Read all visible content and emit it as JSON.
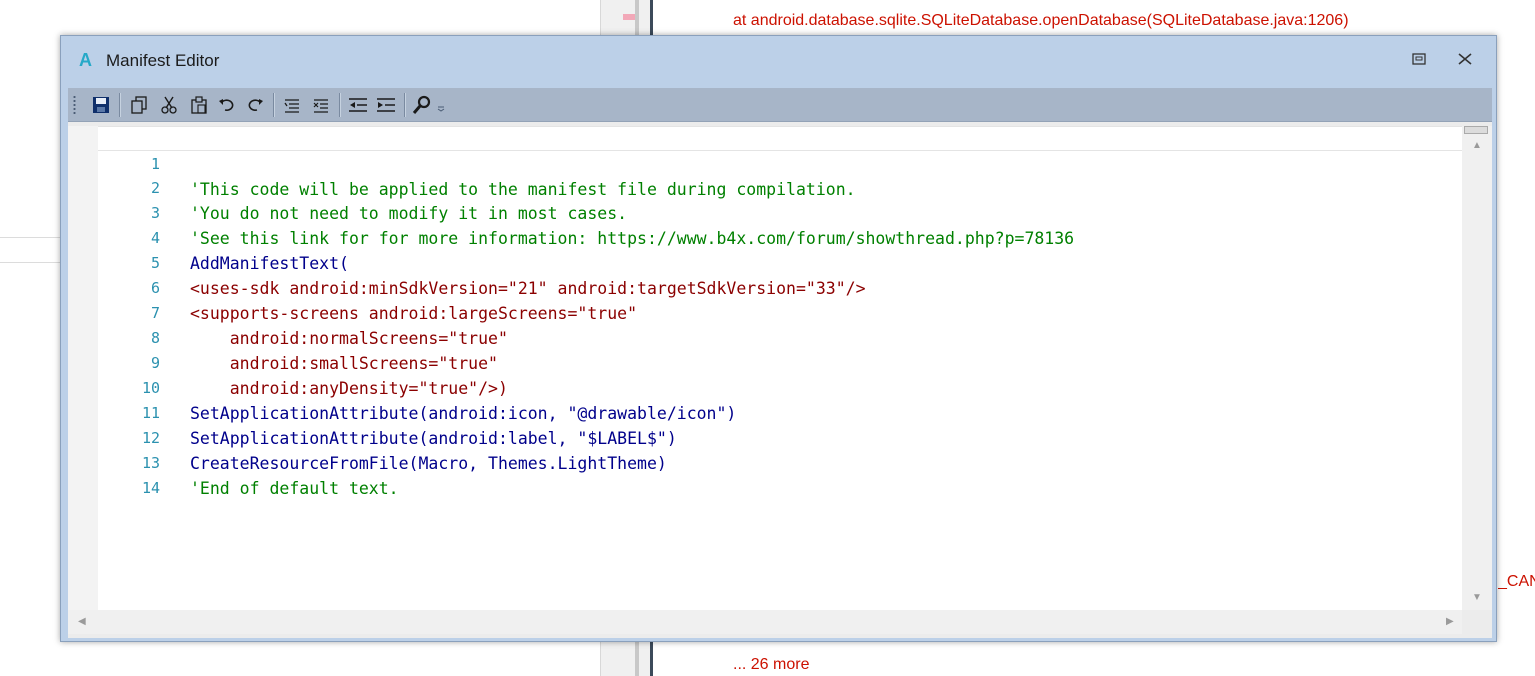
{
  "background": {
    "log_lines": [
      "at android.database.sqlite.SQLiteDatabase.openDatabase(SQLiteDatabase.java:1206)",
      "... 26 more"
    ],
    "partial_right_text": "_CAN"
  },
  "window": {
    "title": "Manifest Editor",
    "logo_letter": "A"
  },
  "toolbar": {
    "buttons": [
      "save-icon",
      "copy-icon",
      "cut-icon",
      "paste-icon",
      "undo-icon",
      "redo-icon",
      "comment-icon",
      "uncomment-icon",
      "outdent-icon",
      "indent-icon",
      "find-icon"
    ]
  },
  "editor": {
    "lines": [
      {
        "num": "1",
        "text": "'This code will be applied to the manifest file during compilation."
      },
      {
        "num": "2",
        "text": "'You do not need to modify it in most cases."
      },
      {
        "num": "3",
        "text": "'See this link for for more information: https://www.b4x.com/forum/showthread.php?p=78136"
      },
      {
        "num": "4",
        "text": "AddManifestText("
      },
      {
        "num": "5",
        "text": "<uses-sdk android:minSdkVersion=\"21\" android:targetSdkVersion=\"33\"/>"
      },
      {
        "num": "6",
        "text": "<supports-screens android:largeScreens=\"true\""
      },
      {
        "num": "7",
        "text": "    android:normalScreens=\"true\""
      },
      {
        "num": "8",
        "text": "    android:smallScreens=\"true\""
      },
      {
        "num": "9",
        "text": "    android:anyDensity=\"true\"/>)"
      },
      {
        "num": "10",
        "text": "SetApplicationAttribute(android:icon, \"@drawable/icon\")"
      },
      {
        "num": "11",
        "text": "SetApplicationAttribute(android:label, \"$LABEL$\")"
      },
      {
        "num": "12",
        "text": "CreateResourceFromFile(Macro, Themes.LightTheme)"
      },
      {
        "num": "13",
        "text": "'End of default text."
      },
      {
        "num": "14",
        "text": ""
      }
    ]
  },
  "colors": {
    "comment": "#008000",
    "function": "#00008b",
    "attribute": "#8b0000",
    "line_number": "#2b91af",
    "log_error": "#cc1100"
  }
}
